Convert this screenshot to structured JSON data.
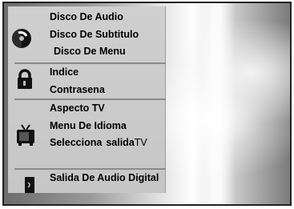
{
  "menu": {
    "groups": [
      {
        "icon": "disc-icon",
        "items": [
          "Disco De Audio",
          "Disco De Subtitulo",
          "Disco De Menu"
        ]
      },
      {
        "icon": "lock-icon",
        "items": [
          "Indice",
          "Contrasena"
        ]
      },
      {
        "icon": "tv-icon",
        "items": [
          "Aspecto TV",
          "Menu De Idioma"
        ],
        "select_output": {
          "prefix": "Selecciona",
          "word": "salida",
          "suffix": "TV"
        }
      },
      {
        "icon": "speaker-icon",
        "items": [
          "Salida De Audio Digital"
        ]
      }
    ]
  },
  "colors": {
    "menu_bg": "#c9c9c9",
    "text": "#000000",
    "divider": "#8a8a8a"
  }
}
